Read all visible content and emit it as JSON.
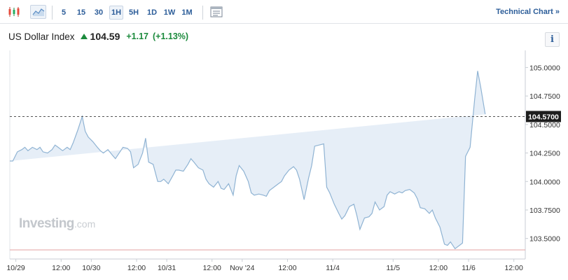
{
  "toolbar": {
    "icons": [
      "candlestick-chart-icon",
      "area-chart-icon",
      "indicator-panel-icon"
    ],
    "intervals": [
      "5",
      "15",
      "30",
      "1H",
      "5H",
      "1D",
      "1W",
      "1M"
    ],
    "active_interval": "1H",
    "technical_chart_label": "Technical Chart »"
  },
  "header": {
    "title": "US Dollar Index",
    "price": "104.59",
    "change": "+1.17",
    "change_pct": "(+1.13%)",
    "info_label": "i",
    "up_color": "#1b8a3c"
  },
  "watermark": {
    "brand": "Investing",
    "suffix": ".com"
  },
  "colors": {
    "line": "#8fb3d3",
    "fill": "#e6eef7",
    "last_price_box": "#1d1d1d",
    "low_line": "#e3a0a0"
  },
  "chart_data": {
    "type": "area",
    "last_price_label": "104.5700",
    "last_price": 104.57,
    "low_reference": 103.4,
    "ylim": [
      103.32,
      105.15
    ],
    "yticks": [
      {
        "label": "105.0000",
        "value": 105.0
      },
      {
        "label": "104.7500",
        "value": 104.75
      },
      {
        "label": "104.5000",
        "value": 104.5
      },
      {
        "label": "104.2500",
        "value": 104.25
      },
      {
        "label": "104.0000",
        "value": 104.0
      },
      {
        "label": "103.7500",
        "value": 103.75
      },
      {
        "label": "103.5000",
        "value": 103.5
      }
    ],
    "xticks": [
      {
        "label": "10/29",
        "x": 0.4
      },
      {
        "label": "12:00",
        "x": 3.4
      },
      {
        "label": "10/30",
        "x": 5.4
      },
      {
        "label": "12:00",
        "x": 8.4
      },
      {
        "label": "10/31",
        "x": 10.4
      },
      {
        "label": "12:00",
        "x": 13.4
      },
      {
        "label": "Nov '24",
        "x": 15.4
      },
      {
        "label": "12:00",
        "x": 18.4
      },
      {
        "label": "11/4",
        "x": 21.4
      },
      {
        "label": "11/5",
        "x": 25.4
      },
      {
        "label": "12:00",
        "x": 28.4
      },
      {
        "label": "11/6",
        "x": 30.4
      },
      {
        "label": "12:00",
        "x": 33.4
      }
    ],
    "xlim": [
      0,
      33.6
    ],
    "x": [
      0.0,
      0.2,
      0.5,
      0.8,
      1.0,
      1.2,
      1.5,
      1.8,
      2.0,
      2.2,
      2.5,
      2.8,
      3.0,
      3.2,
      3.5,
      3.8,
      4.0,
      4.2,
      4.5,
      4.8,
      5.0,
      5.2,
      5.5,
      5.8,
      6.0,
      6.2,
      6.5,
      6.8,
      7.0,
      7.2,
      7.5,
      7.8,
      8.0,
      8.2,
      8.5,
      8.8,
      9.0,
      9.2,
      9.5,
      9.8,
      10.0,
      10.2,
      10.5,
      10.8,
      11.0,
      11.2,
      11.5,
      11.8,
      12.0,
      12.2,
      12.5,
      12.8,
      13.0,
      13.2,
      13.5,
      13.8,
      14.0,
      14.2,
      14.5,
      14.8,
      15.0,
      15.2,
      15.5,
      15.8,
      16.0,
      16.2,
      16.5,
      16.8,
      17.0,
      17.2,
      17.5,
      17.8,
      18.0,
      18.2,
      18.5,
      18.8,
      19.0,
      19.2,
      19.5,
      19.8,
      20.0,
      20.2,
      20.5,
      20.8,
      21.0,
      21.2,
      21.5,
      21.8,
      22.0,
      22.2,
      22.5,
      22.8,
      23.0,
      23.2,
      23.5,
      23.8,
      24.0,
      24.2,
      24.5,
      24.8,
      25.0,
      25.2,
      25.5,
      25.8,
      26.0,
      26.2,
      26.5,
      26.8,
      27.0,
      27.2,
      27.5,
      27.8,
      28.0,
      28.2,
      28.5,
      28.8,
      29.0,
      29.2,
      29.5,
      29.8,
      30.0,
      30.2,
      30.5,
      30.8,
      31.0,
      31.2,
      31.5,
      31.8,
      32.0,
      32.2,
      32.5,
      32.8,
      33.0,
      33.2,
      33.5
    ],
    "values": [
      104.18,
      104.18,
      104.26,
      104.28,
      104.3,
      104.27,
      104.3,
      104.28,
      104.3,
      104.26,
      104.25,
      104.28,
      104.32,
      104.3,
      104.27,
      104.3,
      104.28,
      104.34,
      104.45,
      104.57,
      104.44,
      104.39,
      104.35,
      104.3,
      104.27,
      104.25,
      104.28,
      104.23,
      104.2,
      104.24,
      104.3,
      104.29,
      104.26,
      104.12,
      104.15,
      104.25,
      104.38,
      104.17,
      104.15,
      104.0,
      104.0,
      104.02,
      103.98,
      104.05,
      104.1,
      104.1,
      104.09,
      104.15,
      104.2,
      104.17,
      104.12,
      104.1,
      104.02,
      103.98,
      103.95,
      104.0,
      103.94,
      103.93,
      103.98,
      103.88,
      104.05,
      104.14,
      104.09,
      104.0,
      103.9,
      103.88,
      103.89,
      103.88,
      103.87,
      103.92,
      103.95,
      103.98,
      104.0,
      104.05,
      104.1,
      104.13,
      104.1,
      104.02,
      103.84,
      104.03,
      104.14,
      104.31,
      104.32,
      104.33,
      103.95,
      103.9,
      103.8,
      103.72,
      103.67,
      103.7,
      103.78,
      103.8,
      103.7,
      103.58,
      103.68,
      103.69,
      103.72,
      103.82,
      103.75,
      103.78,
      103.88,
      103.91,
      103.89,
      103.91,
      103.9,
      103.92,
      103.93,
      103.9,
      103.85,
      103.77,
      103.76,
      103.72,
      103.75,
      103.68,
      103.6,
      103.45,
      103.44,
      103.47,
      103.41,
      103.44,
      103.46,
      104.22,
      104.3,
      104.72,
      104.97,
      104.83,
      104.59
    ]
  }
}
